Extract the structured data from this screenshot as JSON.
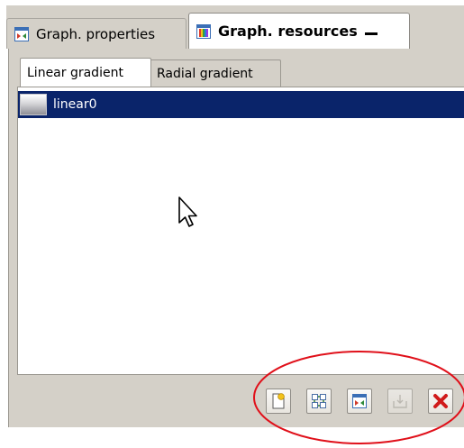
{
  "view_tabs": {
    "inactive_label": "Graph. properties",
    "active_label": "Graph. resources"
  },
  "sub_tabs": {
    "linear_label": "Linear gradient",
    "radial_label": "Radial gradient"
  },
  "gradients": {
    "items": [
      {
        "label": "linear0",
        "selected": true
      }
    ]
  },
  "toolbar": {
    "buttons": [
      {
        "icon": "new-resource-icon",
        "enabled": true
      },
      {
        "icon": "duplicate-resource-icon",
        "enabled": true
      },
      {
        "icon": "edit-resource-icon",
        "enabled": true
      },
      {
        "icon": "import-resource-icon",
        "enabled": false
      },
      {
        "icon": "delete-resource-icon",
        "enabled": true
      }
    ]
  },
  "colors": {
    "selection": "#0a246a",
    "panel": "#d4d0c8",
    "annotation": "#e0101a"
  }
}
